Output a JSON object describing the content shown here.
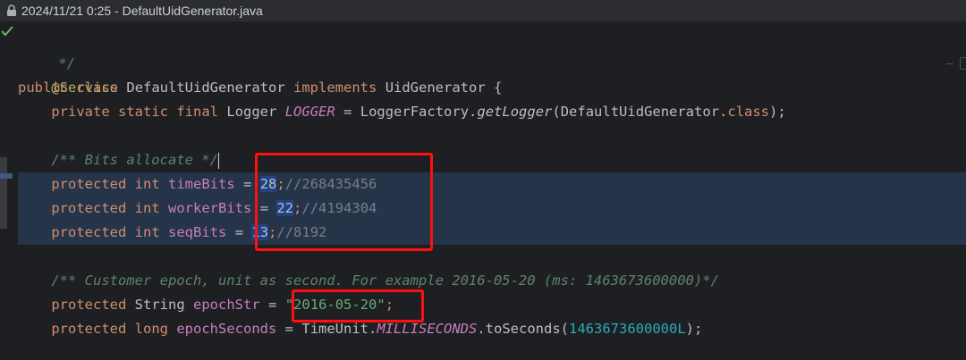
{
  "tab": {
    "title": "2024/11/21 0:25 - DefaultUidGenerator.java",
    "icon": "lock-icon"
  },
  "code": {
    "l1": "*/",
    "l2": "@Service",
    "l3_kw1": "public",
    "l3_kw2": "class",
    "l3_name": "DefaultUidGenerator",
    "l3_kw3": "implements",
    "l3_iface": "UidGenerator",
    "l3_brace": "{",
    "l4_kw1": "private",
    "l4_kw2": "static",
    "l4_kw3": "final",
    "l4_type": "Logger",
    "l4_field": "LOGGER",
    "l4_eq": "=",
    "l4_cls": "LoggerFactory.",
    "l4_meth": "getLogger",
    "l4_args": "(DefaultUidGenerator.",
    "l4_class_kw": "class",
    "l4_end": ");",
    "l6_doc": "/** Bits allocate */",
    "l7_kw": "protected",
    "l7_type": "int",
    "l7_field": "timeBits",
    "l7_eq": "=",
    "l7_num": "28",
    "l7_semi": ";",
    "l7_cmt": "//268435456",
    "l8_kw": "protected",
    "l8_type": "int",
    "l8_field": "workerBits",
    "l8_eq": "=",
    "l8_num": "22",
    "l8_semi": ";",
    "l8_cmt": "//4194304",
    "l9_kw": "protected",
    "l9_type": "int",
    "l9_field": "seqBits",
    "l9_eq": "=",
    "l9_num": "13",
    "l9_semi": ";",
    "l9_cmt": "//8192",
    "l11_doc": "/** Customer epoch, unit as second. For example 2016-05-20 (ms: 1463673600000)*/",
    "l12_kw": "protected",
    "l12_type": "String",
    "l12_field": "epochStr",
    "l12_eq": "=",
    "l12_str": "\"2016-05-20\"",
    "l12_semi": ";",
    "l13_kw1": "protected",
    "l13_kw2": "long",
    "l13_field": "epochSeconds",
    "l13_eq": "=",
    "l13_cls": "TimeUnit.",
    "l13_const": "MILLISECONDS",
    "l13_meth": ".toSeconds(",
    "l13_num": "1463673600000L",
    "l13_end": ");"
  },
  "colors": {
    "background": "#1e1f22",
    "keyword": "#cf8e6d",
    "annotation": "#b3ae60",
    "field": "#c77dbb",
    "string": "#6aab73",
    "number": "#2aacb8",
    "doc_comment": "#5f826b",
    "highlight_box": "#ff1010"
  }
}
